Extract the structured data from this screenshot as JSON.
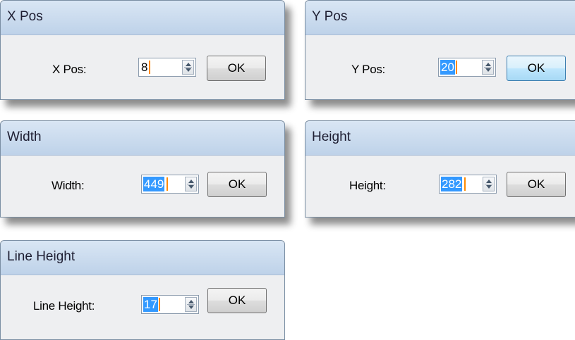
{
  "dialogs": [
    {
      "title": "X Pos",
      "label": "X Pos:",
      "value": "8",
      "selected": false,
      "ok_label": "OK"
    },
    {
      "title": "Y Pos",
      "label": "Y Pos:",
      "value": "20",
      "selected": true,
      "ok_label": "OK"
    },
    {
      "title": "Width",
      "label": "Width:",
      "value": "449",
      "selected": true,
      "ok_label": "OK"
    },
    {
      "title": "Height",
      "label": "Height:",
      "value": "282",
      "selected": true,
      "ok_label": "OK"
    },
    {
      "title": "Line Height",
      "label": "Line Height:",
      "value": "17",
      "selected": true,
      "ok_label": "OK"
    }
  ],
  "colors": {
    "selection": "#3399ff",
    "caret": "#ff8a00",
    "titlebar": "#bed2e9",
    "dialog_bg": "#eeeff1"
  },
  "icons": [
    "spin-up-arrow-icon",
    "spin-down-arrow-icon"
  ]
}
